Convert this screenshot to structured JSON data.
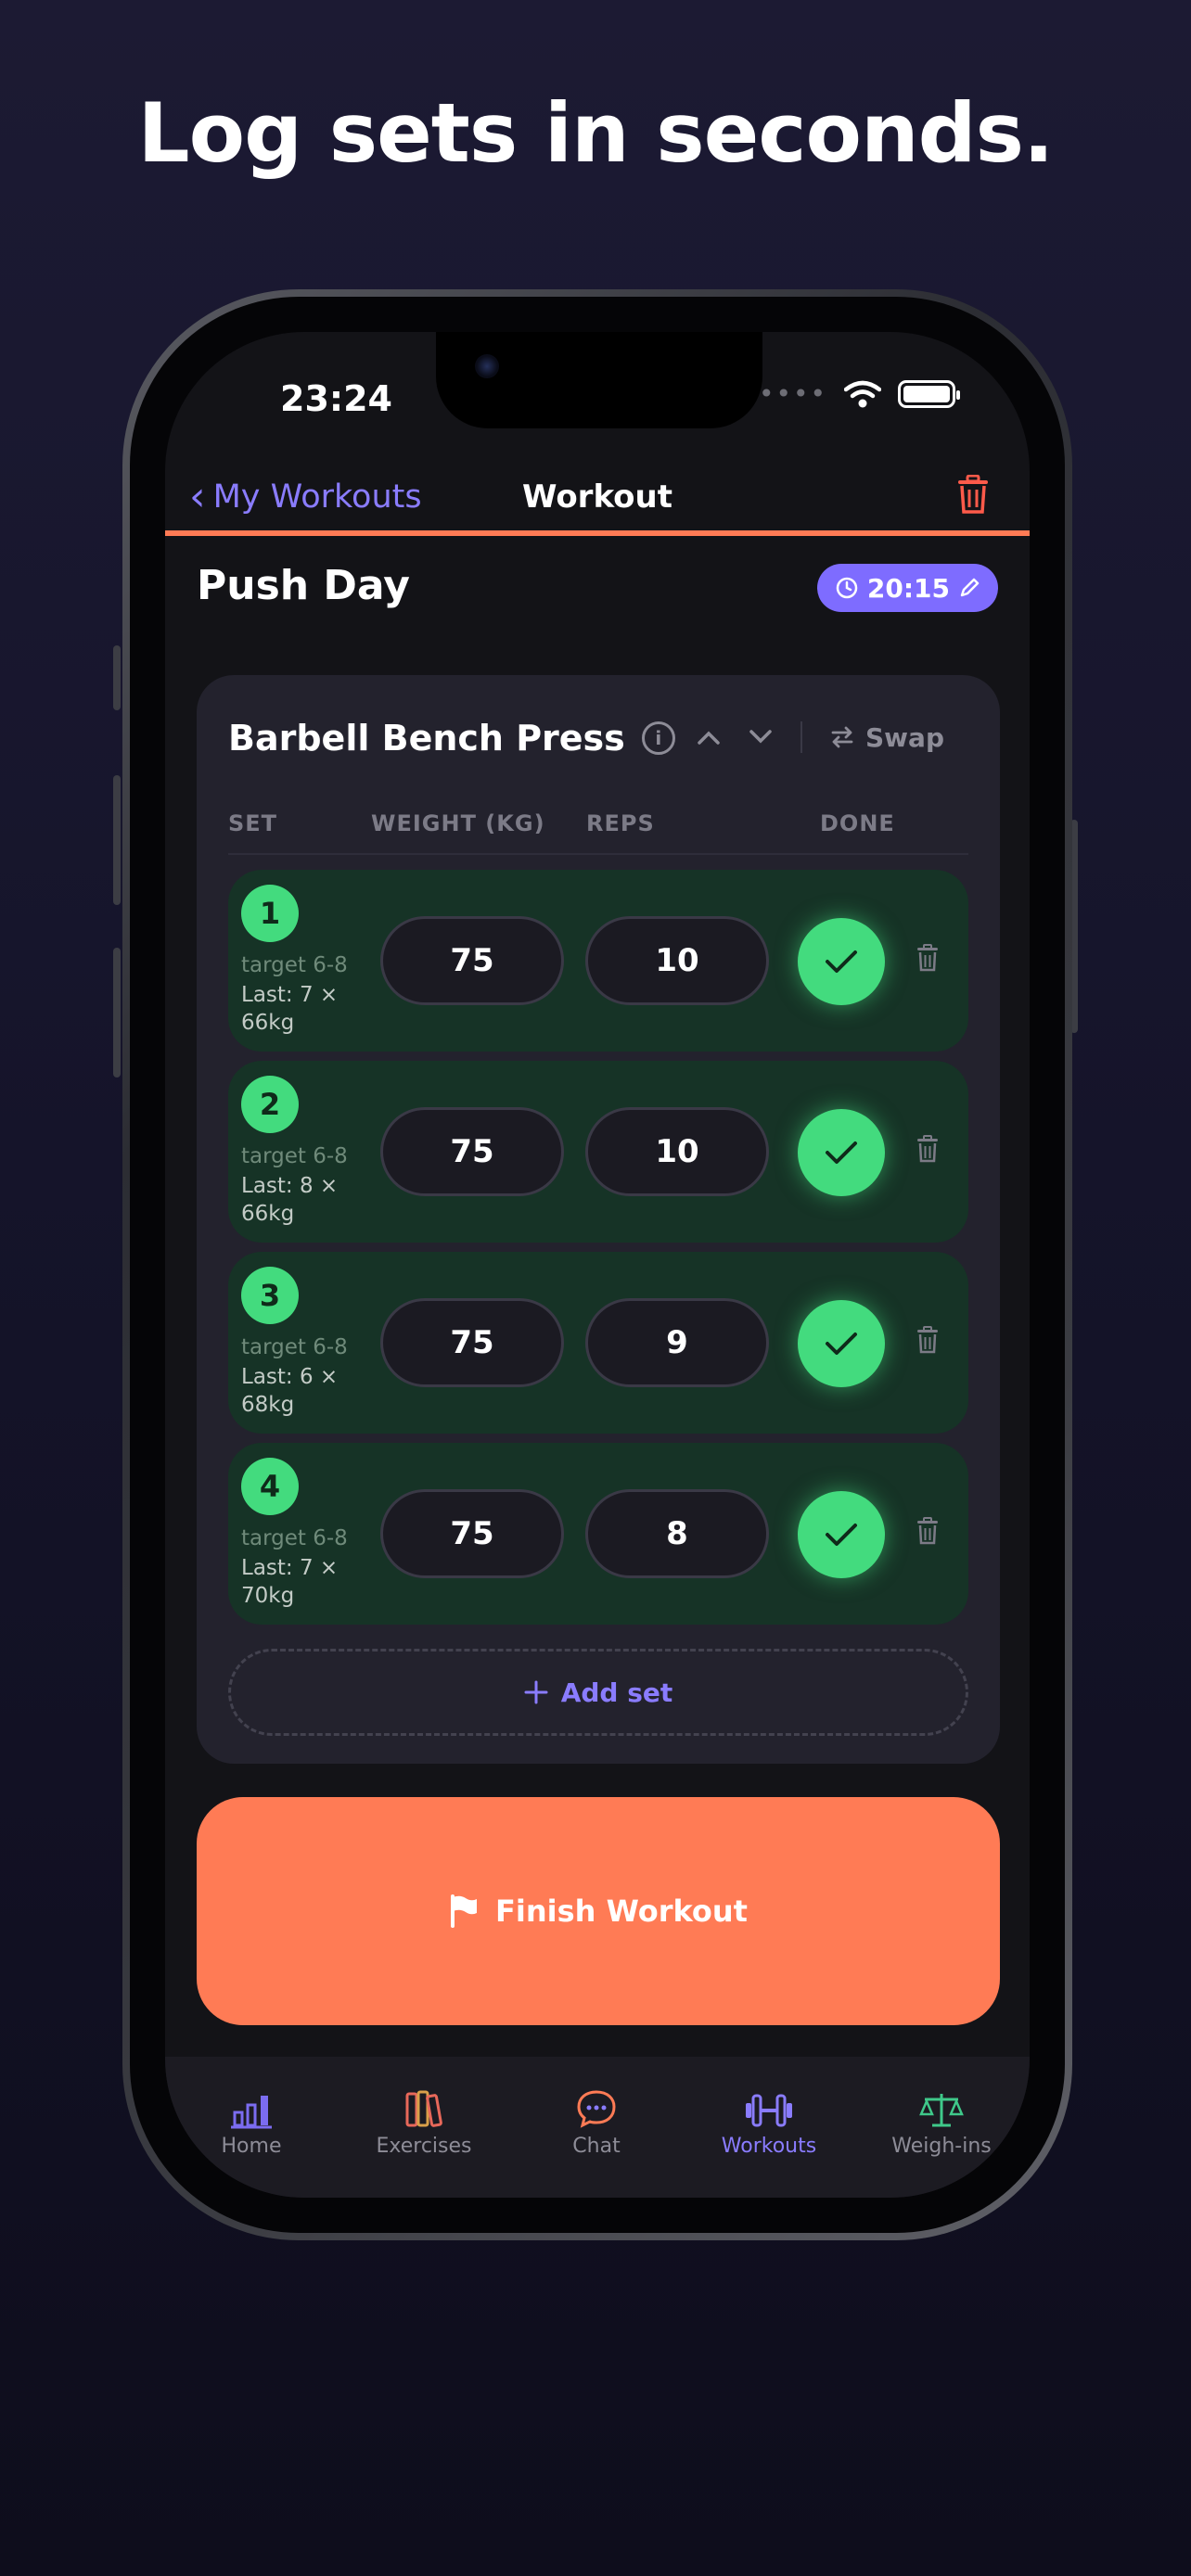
{
  "headline": "Log sets in seconds.",
  "status": {
    "time": "23:24"
  },
  "nav": {
    "back_label": "My Workouts",
    "title": "Workout"
  },
  "workout": {
    "name": "Push Day",
    "timer": "20:15"
  },
  "exercise": {
    "name": "Barbell Bench Press",
    "swap_label": "Swap",
    "columns": {
      "set": "SET",
      "weight": "WEIGHT (KG)",
      "reps": "REPS",
      "done": "DONE"
    },
    "sets": [
      {
        "num": "1",
        "target": "target 6-8",
        "last": "Last: 7 × 66kg",
        "weight": "75",
        "reps": "10",
        "done": true
      },
      {
        "num": "2",
        "target": "target 6-8",
        "last": "Last: 8 × 66kg",
        "weight": "75",
        "reps": "10",
        "done": true
      },
      {
        "num": "3",
        "target": "target 6-8",
        "last": "Last: 6 × 68kg",
        "weight": "75",
        "reps": "9",
        "done": true
      },
      {
        "num": "4",
        "target": "target 6-8",
        "last": "Last: 7 × 70kg",
        "weight": "75",
        "reps": "8",
        "done": true
      }
    ],
    "add_set_label": "Add set"
  },
  "finish_label": "Finish Workout",
  "tabs": [
    {
      "label": "Home",
      "icon": "bar-chart-icon"
    },
    {
      "label": "Exercises",
      "icon": "books-icon"
    },
    {
      "label": "Chat",
      "icon": "chat-bubble-icon"
    },
    {
      "label": "Workouts",
      "icon": "dumbbell-icon",
      "active": true
    },
    {
      "label": "Weigh-ins",
      "icon": "scale-icon"
    }
  ],
  "colors": {
    "accent": "#7e6cff",
    "orange": "#ff7b55",
    "green": "#43db7e"
  }
}
